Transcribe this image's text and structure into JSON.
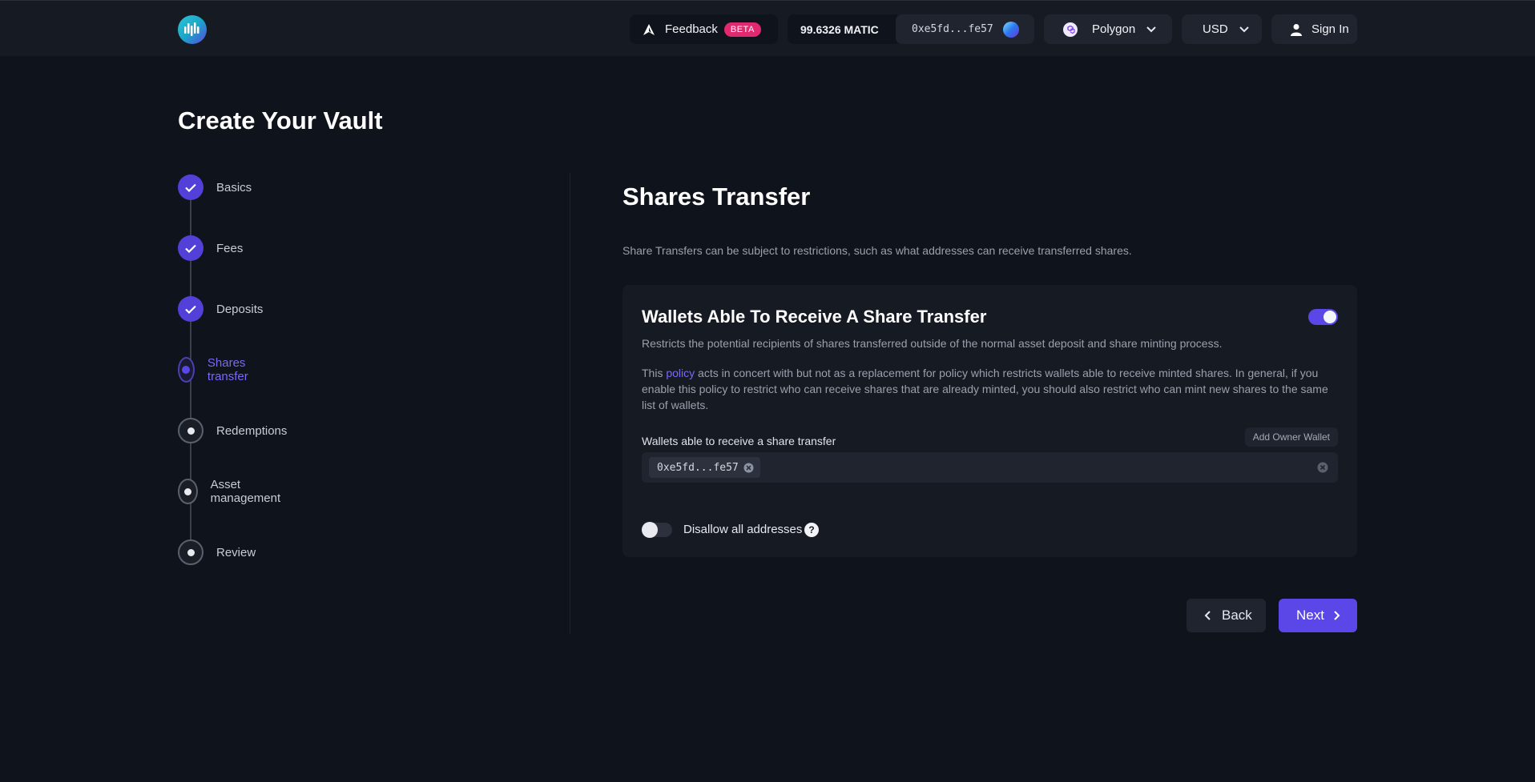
{
  "header": {
    "feedback_label": "Feedback",
    "beta_badge": "BETA",
    "balance": "99.6326 MATIC",
    "wallet_address": "0xe5fd...fe57",
    "network": "Polygon",
    "currency": "USD",
    "sign_in": "Sign In",
    "logo_icon": "waveform-logo-icon"
  },
  "page": {
    "title": "Create Your Vault"
  },
  "stepper": {
    "steps": [
      {
        "label": "Basics",
        "status": "done"
      },
      {
        "label": "Fees",
        "status": "done"
      },
      {
        "label": "Deposits",
        "status": "done"
      },
      {
        "label": "Shares transfer",
        "status": "active"
      },
      {
        "label": "Redemptions",
        "status": "todo"
      },
      {
        "label": "Asset management",
        "status": "todo"
      },
      {
        "label": "Review",
        "status": "todo"
      }
    ]
  },
  "main": {
    "title": "Shares Transfer",
    "description": "Share Transfers can be subject to restrictions, such as what addresses can receive transferred shares.",
    "card": {
      "title": "Wallets Able To Receive A Share Transfer",
      "enabled": true,
      "subtitle": "Restricts the potential recipients of shares transferred outside of the normal asset deposit and share minting process.",
      "note_prefix": "This ",
      "note_link": "policy",
      "note_suffix": " acts in concert with but not as a replacement for policy which restricts wallets able to receive minted shares. In general, if you enable this policy to restrict who can receive shares that are already minted, you should also restrict who can mint new shares to the same list of wallets.",
      "field_label": "Wallets able to receive a share transfer",
      "add_owner_label": "Add Owner Wallet",
      "wallets": [
        "0xe5fd...fe57"
      ],
      "disallow_label": "Disallow all addresses",
      "disallow_enabled": false,
      "help_glyph": "?"
    }
  },
  "actions": {
    "back_label": "Back",
    "next_label": "Next"
  },
  "colors": {
    "background": "#0f131b",
    "accent": "#5b47e8",
    "beta": "#e0296e"
  }
}
